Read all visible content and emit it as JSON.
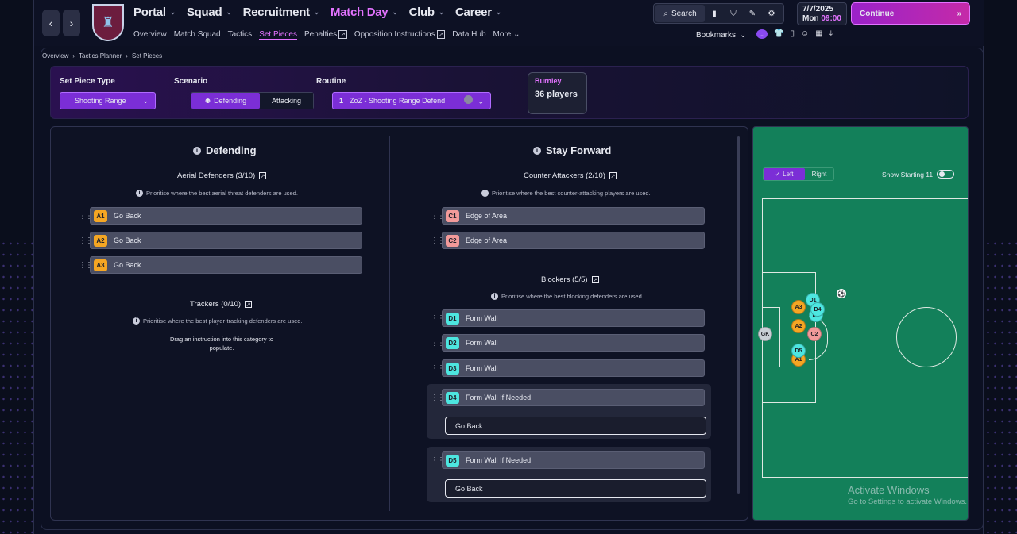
{
  "nav": {
    "main": [
      {
        "label": "Portal"
      },
      {
        "label": "Squad"
      },
      {
        "label": "Recruitment"
      },
      {
        "label": "Match Day"
      },
      {
        "label": "Club"
      },
      {
        "label": "Career"
      }
    ],
    "sub": [
      {
        "label": "Overview"
      },
      {
        "label": "Match Squad"
      },
      {
        "label": "Tactics"
      },
      {
        "label": "Set Pieces"
      },
      {
        "label": "Penalties"
      },
      {
        "label": "Opposition Instructions"
      },
      {
        "label": "Data Hub"
      },
      {
        "label": "More"
      }
    ],
    "search_label": "Search",
    "date": "7/7/2025",
    "day": "Mon",
    "time": "09:00",
    "continue_label": "Continue",
    "bookmarks_label": "Bookmarks"
  },
  "breadcrumb": [
    "Overview",
    "Tactics Planner",
    "Set Pieces"
  ],
  "filters": {
    "set_piece_type_label": "Set Piece Type",
    "set_piece_type_value": "Shooting Range",
    "scenario_label": "Scenario",
    "scenario_options": [
      "Defending",
      "Attacking"
    ],
    "routine_label": "Routine",
    "routine_number": "1",
    "routine_value": "ZoZ - Shooting Range Defend",
    "team_name": "Burnley",
    "team_players": "36 players"
  },
  "left": {
    "title": "Defending",
    "aerial_label": "Aerial Defenders (3/10)",
    "aerial_hint": "Prioritise where the best aerial threat defenders are used.",
    "aerial": [
      {
        "code": "A1",
        "instruction": "Go Back"
      },
      {
        "code": "A2",
        "instruction": "Go Back"
      },
      {
        "code": "A3",
        "instruction": "Go Back"
      }
    ],
    "trackers_label": "Trackers (0/10)",
    "trackers_hint": "Prioritise where the best player-tracking defenders are used.",
    "trackers_empty_1": "Drag an instruction into this category to",
    "trackers_empty_2": "populate."
  },
  "right": {
    "title": "Stay Forward",
    "counter_label": "Counter Attackers (2/10)",
    "counter_hint": "Prioritise where the best counter-attacking players are used.",
    "counter": [
      {
        "code": "C1",
        "instruction": "Edge of Area"
      },
      {
        "code": "C2",
        "instruction": "Edge of Area"
      }
    ],
    "blockers_label": "Blockers (5/5)",
    "blockers_hint": "Prioritise where the best blocking defenders are used.",
    "blockers": [
      {
        "code": "D1",
        "instruction": "Form Wall"
      },
      {
        "code": "D2",
        "instruction": "Form Wall"
      },
      {
        "code": "D3",
        "instruction": "Form Wall"
      }
    ],
    "conditional": [
      {
        "code": "D4",
        "instruction": "Form Wall If Needed",
        "fallback": "Go Back"
      },
      {
        "code": "D5",
        "instruction": "Form Wall If Needed",
        "fallback": "Go Back"
      }
    ]
  },
  "pitch": {
    "side_left": "Left",
    "side_right": "Right",
    "show_starting": "Show Starting 11",
    "players": {
      "gk": "GK",
      "a3": "A3",
      "a2": "A2",
      "a1": "A1",
      "c2": "C2",
      "d1": "D1",
      "d4": "D4",
      "d5": "D5",
      "d3": "D3"
    }
  },
  "watermark": {
    "line1": "Activate Windows",
    "line2": "Go to Settings to activate Windows."
  },
  "colors": {
    "accent": "#e373ff",
    "primary_button": "#7b2ed6",
    "pitch": "#13805a",
    "aerial_badge": "#f5a623",
    "counter_badge": "#f29a9a",
    "blocker_badge": "#4de6e0"
  }
}
